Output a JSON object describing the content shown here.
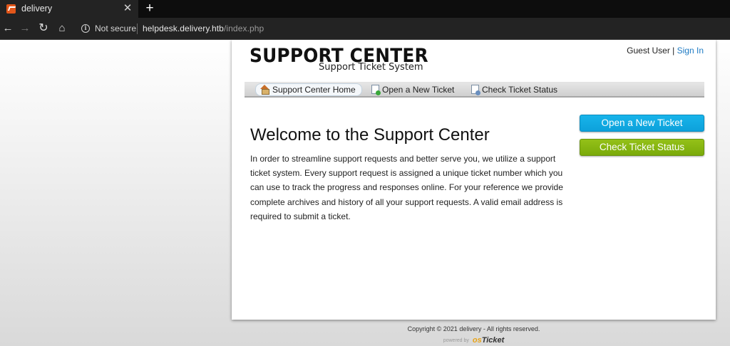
{
  "browser": {
    "tab_title": "delivery",
    "tab_close": "✕",
    "new_tab": "+",
    "security_label": "Not secure",
    "url_host": "helpdesk.delivery.htb",
    "url_path": "/index.php",
    "icons": [
      "back-icon",
      "forward-icon",
      "reload-icon",
      "home-icon",
      "info-icon",
      "favicon"
    ]
  },
  "header": {
    "logo_title": "SUPPORT CENTER",
    "logo_subtitle": "Support Ticket System",
    "guest_label": "Guest User",
    "separator": "|",
    "sign_in": "Sign In"
  },
  "nav": {
    "items": [
      {
        "label": "Support Center Home",
        "icon": "home-icon",
        "active": true
      },
      {
        "label": "Open a New Ticket",
        "icon": "new-ticket-icon",
        "active": false
      },
      {
        "label": "Check Ticket Status",
        "icon": "ticket-status-icon",
        "active": false
      }
    ]
  },
  "main": {
    "heading": "Welcome to the Support Center",
    "body": "In order to streamline support requests and better serve you, we utilize a support ticket system. Every support request is assigned a unique ticket number which you can use to track the progress and responses online. For your reference we provide complete archives and history of all your support requests. A valid email address is required to submit a ticket."
  },
  "sidebar": {
    "open_ticket_button": "Open a New Ticket",
    "check_status_button": "Check Ticket Status"
  },
  "footer": {
    "copyright": "Copyright © 2021 delivery - All rights reserved.",
    "powered_by": "powered by",
    "logo_prefix": "os",
    "logo_name": "Ticket"
  },
  "colors": {
    "accent_blue": "#0da1db",
    "accent_green": "#7aaa0a",
    "link": "#1e7bc4"
  }
}
